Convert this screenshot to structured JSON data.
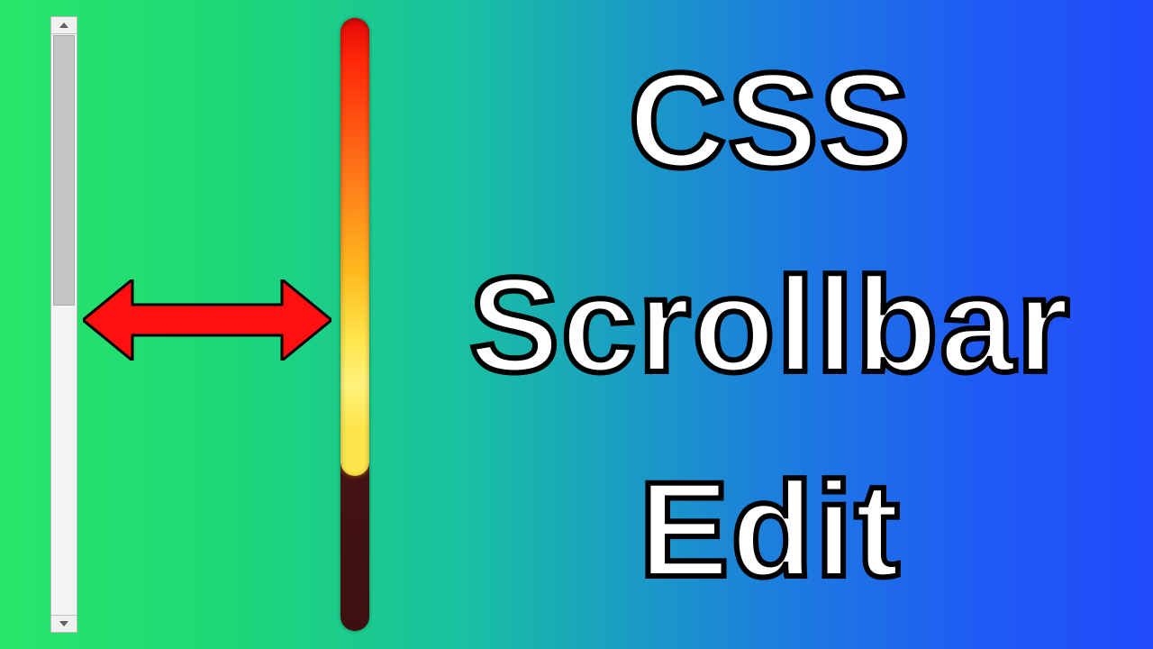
{
  "title": {
    "line1": "CSS",
    "line2": "Scrollbar",
    "line3": "Edit"
  }
}
